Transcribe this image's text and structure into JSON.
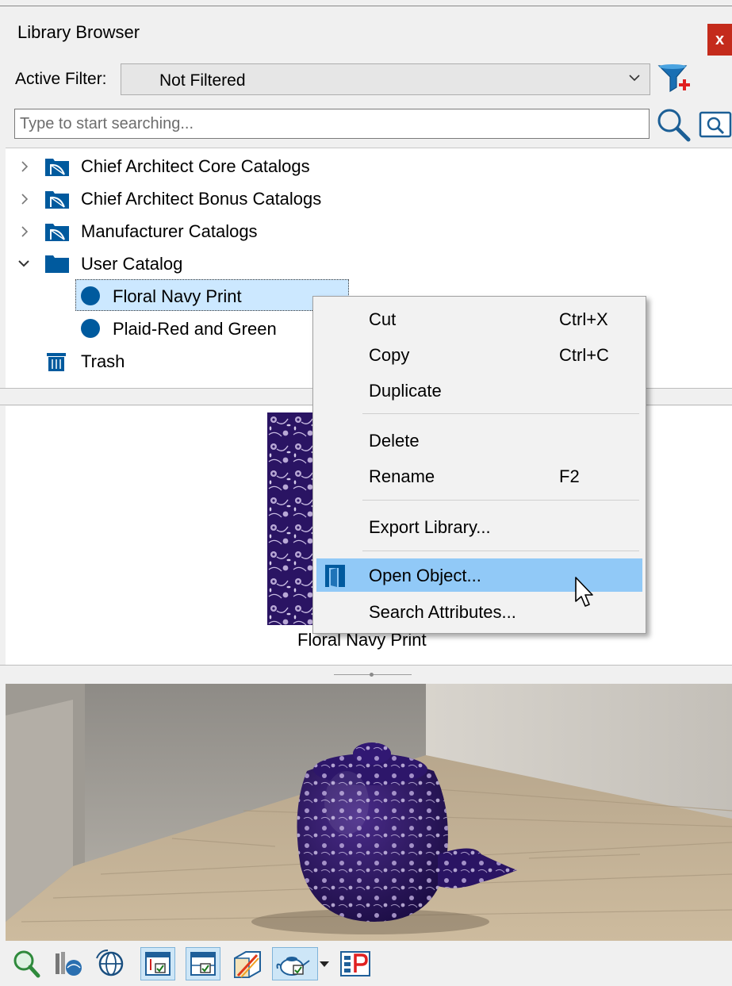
{
  "window": {
    "title": "Library Browser",
    "close_glyph": "x"
  },
  "filter": {
    "label": "Active Filter:",
    "value": "Not Filtered"
  },
  "search": {
    "placeholder": "Type to start searching..."
  },
  "tree": {
    "items": [
      {
        "label": "Chief Architect Core Catalogs",
        "icon": "catalog-folder-icon",
        "expanded": false
      },
      {
        "label": "Chief Architect Bonus Catalogs",
        "icon": "catalog-folder-icon",
        "expanded": false
      },
      {
        "label": "Manufacturer Catalogs",
        "icon": "catalog-folder-icon",
        "expanded": false
      },
      {
        "label": "User Catalog",
        "icon": "folder-icon",
        "expanded": true,
        "children": [
          {
            "label": "Floral Navy Print",
            "icon": "material-dot-icon",
            "selected": true
          },
          {
            "label": "Plaid-Red and Green",
            "icon": "material-dot-icon",
            "selected": false
          }
        ]
      },
      {
        "label": "Trash",
        "icon": "trash-icon"
      }
    ]
  },
  "preview": {
    "caption": "Floral Navy Print"
  },
  "context_menu": {
    "items": [
      {
        "label": "Cut",
        "shortcut": "Ctrl+X"
      },
      {
        "label": "Copy",
        "shortcut": "Ctrl+C"
      },
      {
        "label": "Duplicate",
        "shortcut": ""
      },
      {
        "label": "Delete",
        "shortcut": ""
      },
      {
        "label": "Rename",
        "shortcut": "F2"
      },
      {
        "label": "Export Library...",
        "shortcut": ""
      },
      {
        "label": "Open Object...",
        "shortcut": "",
        "highlighted": true,
        "icon": "open-object-icon"
      },
      {
        "label": "Search Attributes...",
        "shortcut": ""
      }
    ]
  },
  "toolbar": {
    "buttons": [
      {
        "icon": "zoom-search-icon",
        "pressed": false
      },
      {
        "icon": "library-materials-icon",
        "pressed": false
      },
      {
        "icon": "sphere-rotate-icon",
        "pressed": false
      },
      {
        "icon": "show-tree-icon",
        "pressed": true
      },
      {
        "icon": "show-preview-icon",
        "pressed": true
      },
      {
        "icon": "show-3d-view-icon",
        "pressed": false
      },
      {
        "icon": "teapot-preview-icon",
        "pressed": true
      },
      {
        "icon": "dropdown-arrow-icon",
        "pressed": false
      },
      {
        "icon": "properties-icon",
        "pressed": false
      }
    ]
  },
  "colors": {
    "accent_blue": "#005a9e",
    "selection": "#cce8ff",
    "menu_highlight": "#91c9f7",
    "close_red": "#c42b1c",
    "fabric_navy": "#2a1463"
  }
}
